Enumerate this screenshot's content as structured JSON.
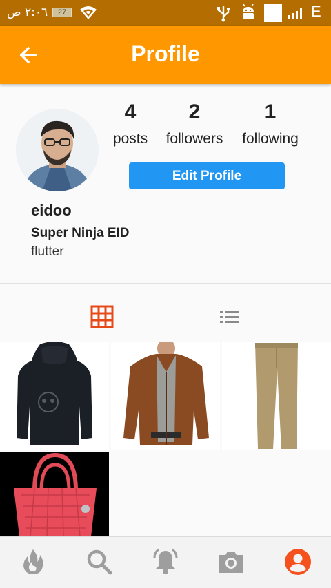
{
  "status_bar": {
    "time": "٢:٠٦ ص",
    "battery": "27",
    "network": "E",
    "icons": [
      "wifi-icon",
      "usb-icon",
      "android-icon",
      "sim-icon",
      "signal-icon"
    ]
  },
  "app_bar": {
    "title": "Profile",
    "back_icon": "arrow-back-icon",
    "color": "#ff9800"
  },
  "profile": {
    "stats": [
      {
        "value": "4",
        "label": "posts"
      },
      {
        "value": "2",
        "label": "followers"
      },
      {
        "value": "1",
        "label": "following"
      }
    ],
    "edit_button": "Edit Profile",
    "username": "eidoo",
    "full_name": "Super Ninja EID",
    "bio": "flutter"
  },
  "view_toggle": {
    "grid_icon": "grid-icon",
    "list_icon": "list-icon",
    "active": "grid",
    "active_color": "#e64a19"
  },
  "posts": [
    {
      "item": "black-hoodie"
    },
    {
      "item": "brown-leather-jacket"
    },
    {
      "item": "khaki-pants"
    },
    {
      "item": "pink-handbag"
    }
  ],
  "bottom_nav": {
    "items": [
      "fire-icon",
      "search-icon",
      "notifications-icon",
      "camera-icon",
      "account-icon"
    ],
    "active": "account-icon",
    "active_color": "#f4511e",
    "inactive_color": "#9e9e9e"
  },
  "colors": {
    "status_bar": "#b36d00",
    "edit_button": "#2196f3"
  }
}
